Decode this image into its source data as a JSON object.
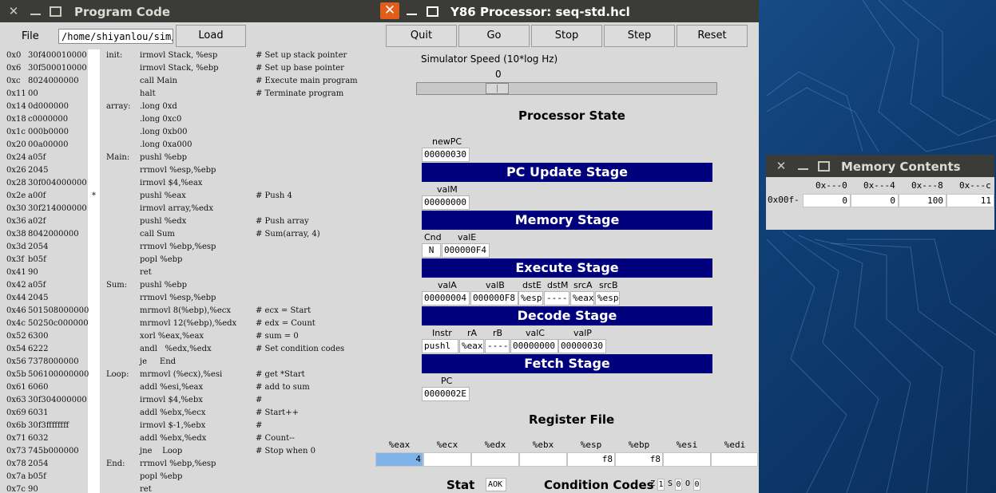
{
  "program_window": {
    "title": "Program Code",
    "file_label": "File",
    "path_value": "/home/shiyanlou/sim/",
    "load_label": "Load",
    "lines": [
      {
        "addr": "0x0",
        "bytes": "30f400010000",
        "mark": "",
        "label": "init:",
        "inst": "irmovl Stack, %esp",
        "comment": "# Set up stack pointer"
      },
      {
        "addr": "0x6",
        "bytes": "30f500010000",
        "mark": "",
        "label": "",
        "inst": "irmovl Stack, %ebp",
        "comment": "# Set up base pointer"
      },
      {
        "addr": "0xc",
        "bytes": "8024000000",
        "mark": "",
        "label": "",
        "inst": "call Main",
        "comment": "# Execute main program"
      },
      {
        "addr": "0x11",
        "bytes": "00",
        "mark": "",
        "label": "",
        "inst": "halt",
        "comment": "# Terminate program"
      },
      {
        "addr": "0x14",
        "bytes": "0d000000",
        "mark": "",
        "label": "array:",
        "inst": ".long 0xd",
        "comment": ""
      },
      {
        "addr": "0x18",
        "bytes": "c0000000",
        "mark": "",
        "label": "",
        "inst": ".long 0xc0",
        "comment": ""
      },
      {
        "addr": "0x1c",
        "bytes": "000b0000",
        "mark": "",
        "label": "",
        "inst": ".long 0xb00",
        "comment": ""
      },
      {
        "addr": "0x20",
        "bytes": "00a00000",
        "mark": "",
        "label": "",
        "inst": ".long 0xa000",
        "comment": ""
      },
      {
        "addr": "0x24",
        "bytes": "a05f",
        "mark": "",
        "label": "Main:",
        "inst": "pushl %ebp",
        "comment": ""
      },
      {
        "addr": "0x26",
        "bytes": "2045",
        "mark": "",
        "label": "",
        "inst": "rrmovl %esp,%ebp",
        "comment": ""
      },
      {
        "addr": "0x28",
        "bytes": "30f004000000",
        "mark": "",
        "label": "",
        "inst": "irmovl $4,%eax",
        "comment": ""
      },
      {
        "addr": "0x2e",
        "bytes": "a00f",
        "mark": "*",
        "label": "",
        "inst": "pushl %eax",
        "comment": "# Push 4"
      },
      {
        "addr": "0x30",
        "bytes": "30f214000000",
        "mark": "",
        "label": "",
        "inst": "irmovl array,%edx",
        "comment": ""
      },
      {
        "addr": "0x36",
        "bytes": "a02f",
        "mark": "",
        "label": "",
        "inst": "pushl %edx",
        "comment": "# Push array"
      },
      {
        "addr": "0x38",
        "bytes": "8042000000",
        "mark": "",
        "label": "",
        "inst": "call Sum",
        "comment": "# Sum(array, 4)"
      },
      {
        "addr": "0x3d",
        "bytes": "2054",
        "mark": "",
        "label": "",
        "inst": "rrmovl %ebp,%esp",
        "comment": ""
      },
      {
        "addr": "0x3f",
        "bytes": "b05f",
        "mark": "",
        "label": "",
        "inst": "popl %ebp",
        "comment": ""
      },
      {
        "addr": "0x41",
        "bytes": "90",
        "mark": "",
        "label": "",
        "inst": "ret",
        "comment": ""
      },
      {
        "addr": "0x42",
        "bytes": "a05f",
        "mark": "",
        "label": "Sum:",
        "inst": "pushl %ebp",
        "comment": ""
      },
      {
        "addr": "0x44",
        "bytes": "2045",
        "mark": "",
        "label": "",
        "inst": "rrmovl %esp,%ebp",
        "comment": ""
      },
      {
        "addr": "0x46",
        "bytes": "501508000000",
        "mark": "",
        "label": "",
        "inst": "mrmovl 8(%ebp),%ecx",
        "comment": "# ecx = Start"
      },
      {
        "addr": "0x4c",
        "bytes": "50250c000000",
        "mark": "",
        "label": "",
        "inst": "mrmovl 12(%ebp),%edx",
        "comment": "# edx = Count"
      },
      {
        "addr": "0x52",
        "bytes": "6300",
        "mark": "",
        "label": "",
        "inst": "xorl %eax,%eax",
        "comment": "# sum = 0"
      },
      {
        "addr": "0x54",
        "bytes": "6222",
        "mark": "",
        "label": "",
        "inst": "andl   %edx,%edx",
        "comment": "# Set condition codes"
      },
      {
        "addr": "0x56",
        "bytes": "7378000000",
        "mark": "",
        "label": "",
        "inst": "je     End",
        "comment": ""
      },
      {
        "addr": "0x5b",
        "bytes": "506100000000",
        "mark": "",
        "label": "Loop:",
        "inst": "mrmovl (%ecx),%esi",
        "comment": "# get *Start"
      },
      {
        "addr": "0x61",
        "bytes": "6060",
        "mark": "",
        "label": "",
        "inst": "addl %esi,%eax",
        "comment": "# add to sum"
      },
      {
        "addr": "0x63",
        "bytes": "30f304000000",
        "mark": "",
        "label": "",
        "inst": "irmovl $4,%ebx",
        "comment": "#"
      },
      {
        "addr": "0x69",
        "bytes": "6031",
        "mark": "",
        "label": "",
        "inst": "addl %ebx,%ecx",
        "comment": "# Start++"
      },
      {
        "addr": "0x6b",
        "bytes": "30f3ffffffff",
        "mark": "",
        "label": "",
        "inst": "irmovl $-1,%ebx",
        "comment": "#"
      },
      {
        "addr": "0x71",
        "bytes": "6032",
        "mark": "",
        "label": "",
        "inst": "addl %ebx,%edx",
        "comment": "# Count--"
      },
      {
        "addr": "0x73",
        "bytes": "745b000000",
        "mark": "",
        "label": "",
        "inst": "jne    Loop",
        "comment": "# Stop when 0"
      },
      {
        "addr": "0x78",
        "bytes": "2054",
        "mark": "",
        "label": "End:",
        "inst": "rrmovl %ebp,%esp",
        "comment": ""
      },
      {
        "addr": "0x7a",
        "bytes": "b05f",
        "mark": "",
        "label": "",
        "inst": "popl %ebp",
        "comment": ""
      },
      {
        "addr": "0x7c",
        "bytes": "90",
        "mark": "",
        "label": "",
        "inst": "ret",
        "comment": ""
      }
    ]
  },
  "y86_window": {
    "title": "Y86 Processor: seq-std.hcl",
    "buttons": {
      "quit": "Quit",
      "go": "Go",
      "stop": "Stop",
      "step": "Step",
      "reset": "Reset"
    },
    "speed_label": "Simulator Speed (10*log Hz)",
    "speed_value": "0",
    "speed_fraction": 0.25,
    "processor_state_heading": "Processor State",
    "newpc_label": "newPC",
    "newpc": "00000030",
    "pc_update_stage": "PC Update Stage",
    "valm_label": "valM",
    "valm": "00000000",
    "memory_stage": "Memory Stage",
    "cnd_label": "Cnd",
    "cnd": "N",
    "vale_label": "valE",
    "vale": "000000F4",
    "execute_stage": "Execute Stage",
    "decode_labels": {
      "vala": "valA",
      "valb": "valB",
      "dste": "dstE",
      "dstm": "dstM",
      "srca": "srcA",
      "srcb": "srcB"
    },
    "decode_values": {
      "vala": "00000004",
      "valb": "000000F8",
      "dste": "%esp",
      "dstm": "----",
      "srca": "%eax",
      "srcb": "%esp"
    },
    "decode_stage": "Decode Stage",
    "fetch_labels": {
      "instr": "Instr",
      "ra": "rA",
      "rb": "rB",
      "valc": "valC",
      "valp": "valP"
    },
    "fetch_values": {
      "instr": "pushl",
      "ra": "%eax",
      "rb": "----",
      "valc": "00000000",
      "valp": "00000030"
    },
    "fetch_stage": "Fetch Stage",
    "pc_label": "PC",
    "pc": "0000002E",
    "register_file_heading": "Register File",
    "registers": {
      "eax": {
        "name": "%eax",
        "value": "4"
      },
      "ecx": {
        "name": "%ecx",
        "value": ""
      },
      "edx": {
        "name": "%edx",
        "value": ""
      },
      "ebx": {
        "name": "%ebx",
        "value": ""
      },
      "esp": {
        "name": "%esp",
        "value": "f8"
      },
      "ebp": {
        "name": "%ebp",
        "value": "f8"
      },
      "esi": {
        "name": "%esi",
        "value": ""
      },
      "edi": {
        "name": "%edi",
        "value": ""
      }
    },
    "stat_label": "Stat",
    "stat": "AOK",
    "condition_codes_label": "Condition Codes",
    "cc": {
      "z_label": "Z",
      "z": "1",
      "s_label": "S",
      "s": "0",
      "o_label": "O",
      "o": "0"
    }
  },
  "memory_window": {
    "title": "Memory Contents",
    "col_headers": {
      "c0": "0x---0",
      "c4": "0x---4",
      "c8": "0x---8",
      "cc": "0x---c"
    },
    "row_label": "0x00f-",
    "values": {
      "c0": "0",
      "c4": "0",
      "c8": "100",
      "cc": "11"
    }
  },
  "colors": {
    "stage_bar": "#00007d",
    "close_button": "#e05d1c",
    "titlebar": "#3b3b37",
    "register_highlight": "#7fb3ea"
  }
}
